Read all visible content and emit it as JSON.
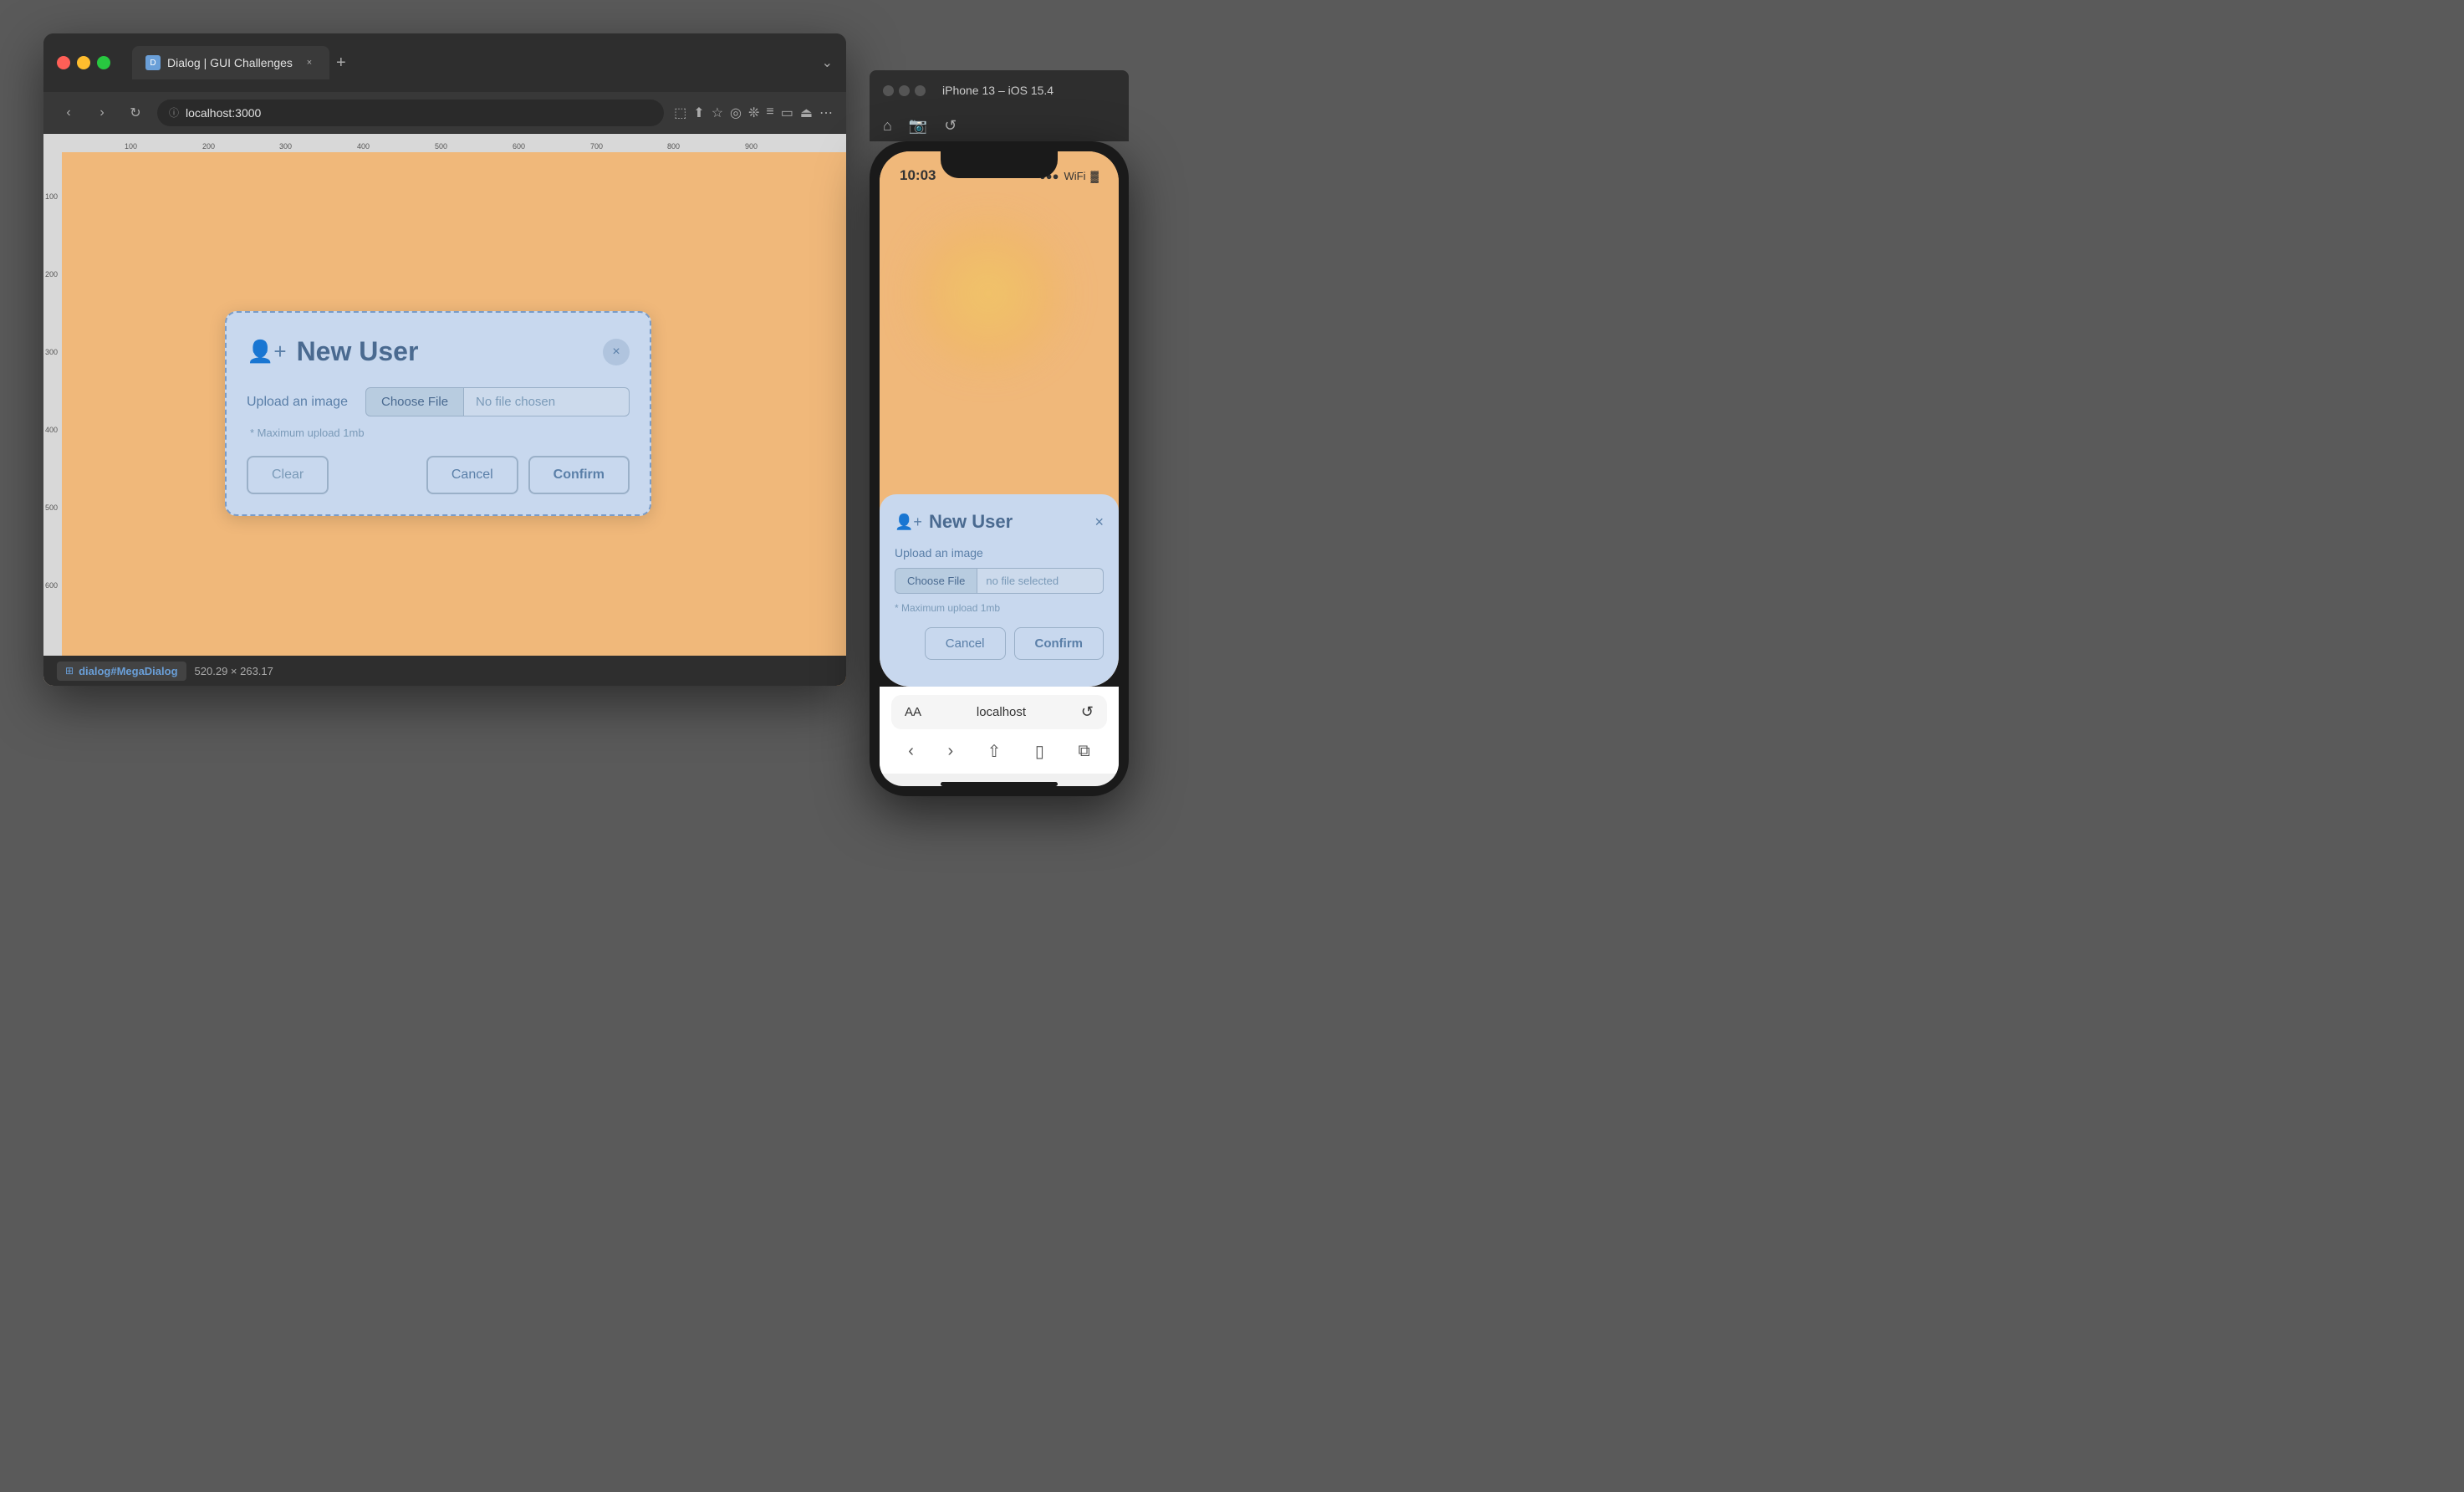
{
  "browser": {
    "tab_title": "Dialog | GUI Challenges",
    "url": "localhost:3000",
    "traffic_lights": [
      "red",
      "yellow",
      "green"
    ],
    "nav_back": "‹",
    "nav_forward": "›",
    "nav_refresh": "↺",
    "tab_close": "×",
    "tab_new": "+",
    "window_chevron": "⌄"
  },
  "dialog": {
    "title": "New User",
    "close_label": "×",
    "upload_label": "Upload an image",
    "choose_file_label": "Choose File",
    "no_file_label": "No file chosen",
    "upload_hint": "* Maximum upload 1mb",
    "clear_label": "Clear",
    "cancel_label": "Cancel",
    "confirm_label": "Confirm"
  },
  "iphone": {
    "window_title": "iPhone 13 – iOS 15.4",
    "time": "10:03",
    "signal": "...",
    "wifi": "WiFi",
    "battery": "▓",
    "dialog": {
      "title": "New User",
      "close_label": "×",
      "upload_label": "Upload an image",
      "choose_file_label": "Choose File",
      "no_file_label": "no file selected",
      "upload_hint": "* Maximum upload 1mb",
      "cancel_label": "Cancel",
      "confirm_label": "Confirm"
    },
    "url_bar": {
      "aa": "AA",
      "url": "localhost",
      "refresh": "↺"
    },
    "nav": [
      "‹",
      "›",
      "⬆",
      "□",
      "⧉"
    ]
  },
  "status_bar": {
    "badge_icon": "⊞",
    "badge_text": "dialog#MegaDialog",
    "dimensions": "520.29 × 263.17"
  },
  "ruler": {
    "marks_h": [
      "100",
      "200",
      "300",
      "400",
      "500",
      "600",
      "700",
      "800",
      "900"
    ],
    "marks_v": [
      "100",
      "200",
      "300",
      "400",
      "500",
      "600"
    ]
  }
}
